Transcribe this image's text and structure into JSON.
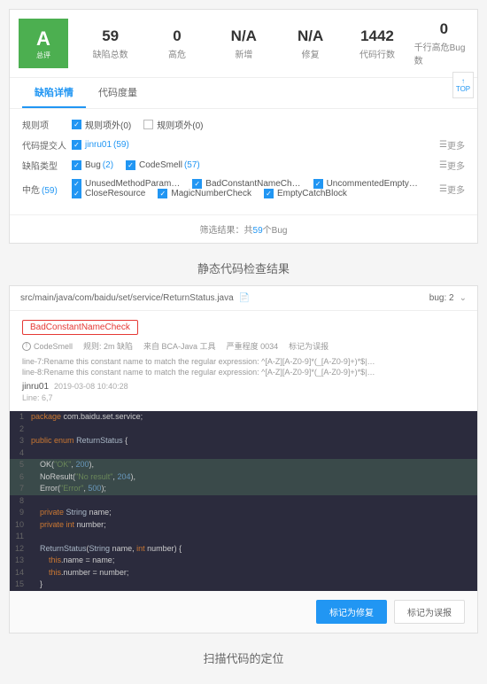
{
  "panel1": {
    "grade": {
      "letter": "A",
      "sub": "总评"
    },
    "stats": [
      {
        "val": "59",
        "lbl": "缺陷总数"
      },
      {
        "val": "0",
        "lbl": "高危"
      },
      {
        "val": "N/A",
        "lbl": "新增"
      },
      {
        "val": "N/A",
        "lbl": "修复"
      },
      {
        "val": "1442",
        "lbl": "代码行数"
      },
      {
        "val": "0",
        "lbl": "千行高危Bug数"
      }
    ],
    "tabs": [
      {
        "label": "缺陷详情",
        "active": true
      },
      {
        "label": "代码度量",
        "active": false
      }
    ],
    "filters": {
      "row1": {
        "label": "规则项",
        "items": [
          {
            "checked": true,
            "text": "规则项外(0)",
            "countClass": "cnt-red"
          },
          {
            "checked": false,
            "text": "规则项外(0)",
            "countClass": "cnt-red"
          }
        ]
      },
      "row2": {
        "label": "代码提交人",
        "value": "jinru01",
        "count": "(59)"
      },
      "row3": {
        "label": "缺陷类型",
        "items": [
          {
            "checked": true,
            "text": "Bug",
            "count": "(2)"
          },
          {
            "checked": true,
            "text": "CodeSmell",
            "count": "(57)"
          }
        ],
        "more": "更多"
      },
      "row4": {
        "label": "中危",
        "count": "(59)",
        "items": [
          {
            "checked": true,
            "text": "UnusedMethodParam…"
          },
          {
            "checked": true,
            "text": "BadConstantNameCh…"
          },
          {
            "checked": true,
            "text": "UncommentedEmpty…"
          },
          {
            "checked": true,
            "text": "CloseResource"
          },
          {
            "checked": true,
            "text": "MagicNumberCheck"
          },
          {
            "checked": true,
            "text": "EmptyCatchBlock"
          }
        ],
        "more": "更多"
      }
    },
    "summary": {
      "prefix": "筛选结果：共",
      "count": "59",
      "suffix": "个Bug"
    },
    "topBtn": "TOP"
  },
  "caption1": "静态代码检查结果",
  "panel2": {
    "path": "src/main/java/com/baidu/set/service/ReturnStatus.java",
    "bugCount": "bug: 2",
    "tag": "BadConstantNameCheck",
    "meta": [
      {
        "icon": "warn",
        "text": "CodeSmell"
      },
      {
        "text": "规则: 2m 缺陷"
      },
      {
        "text": "来自 BCA-Java 工具"
      },
      {
        "text": "严重程度 0034"
      },
      {
        "text": "标记为误报"
      }
    ],
    "desc": [
      "line-7:Rename this constant name to match the regular expression: ^[A-Z][A-Z0-9]*(_[A-Z0-9]+)*$|…",
      "line-8:Rename this constant name to match the regular expression: ^[A-Z][A-Z0-9]*(_[A-Z0-9]+)*$|…"
    ],
    "author": "jinru01",
    "date": "2019-03-08 10:40:28",
    "lineRef": "Line: 6,7",
    "code": [
      {
        "n": 1,
        "t": "package com.baidu.set.service;",
        "cls": ""
      },
      {
        "n": 2,
        "t": "",
        "cls": ""
      },
      {
        "n": 3,
        "t": "public enum ReturnStatus {",
        "cls": ""
      },
      {
        "n": 4,
        "t": "",
        "cls": ""
      },
      {
        "n": 5,
        "t": "    OK(\"OK\", 200),",
        "cls": "hl"
      },
      {
        "n": 6,
        "t": "    NoResult(\"No result\", 204),",
        "cls": "hl"
      },
      {
        "n": 7,
        "t": "    Error(\"Error\", 500);",
        "cls": "hl"
      },
      {
        "n": 8,
        "t": "",
        "cls": ""
      },
      {
        "n": 9,
        "t": "    private String name;",
        "cls": ""
      },
      {
        "n": 10,
        "t": "    private int number;",
        "cls": ""
      },
      {
        "n": 11,
        "t": "",
        "cls": ""
      },
      {
        "n": 12,
        "t": "    ReturnStatus(String name, int number) {",
        "cls": ""
      },
      {
        "n": 13,
        "t": "        this.name = name;",
        "cls": ""
      },
      {
        "n": 14,
        "t": "        this.number = number;",
        "cls": ""
      },
      {
        "n": 15,
        "t": "    }",
        "cls": ""
      }
    ],
    "buttons": {
      "mark": "标记为修复",
      "ignore": "标记为误报"
    }
  },
  "caption2": "扫描代码的定位"
}
